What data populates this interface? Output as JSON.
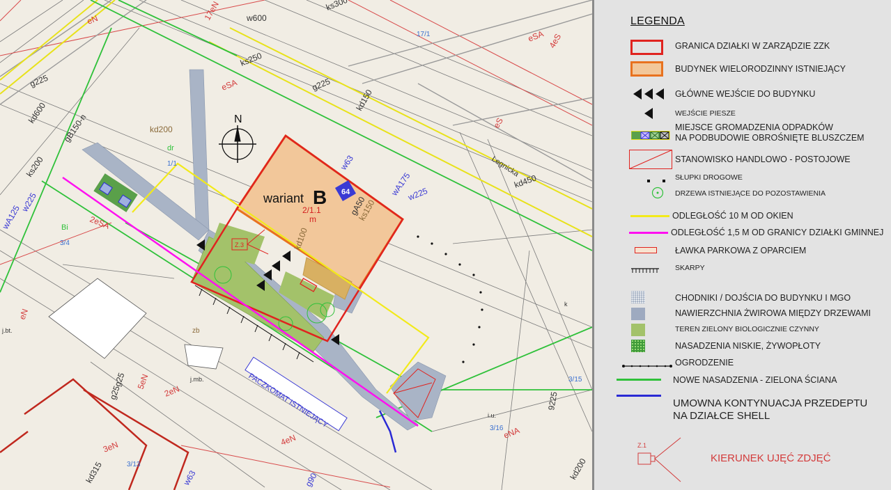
{
  "legend": {
    "title": "LEGENDA",
    "items": [
      {
        "key": "plot_border",
        "label": "GRANICA DZIAŁKI W ZARZĄDZIE ZZK"
      },
      {
        "key": "building",
        "label": "BUDYNEK WIELORODZINNY ISTNIEJĄCY"
      },
      {
        "key": "main_entrance",
        "label": "GŁÓWNE WEJŚCIE DO BUDYNKU"
      },
      {
        "key": "pedestrian_entrance",
        "label": "WEJŚCIE PIESZE"
      },
      {
        "key": "waste_area",
        "label": "MIEJSCE GROMADZENIA ODPADKÓW",
        "label2": "NA PODBUDOWIE OBROŚNIĘTE BLUSZCZEM"
      },
      {
        "key": "trade_stand",
        "label": "STANOWISKO HANDLOWO - POSTOJOWE"
      },
      {
        "key": "road_posts",
        "label": "SŁUPKI DROGOWE"
      },
      {
        "key": "trees",
        "label": "DRZEWA ISTNIEJĄCE DO POZOSTAWIENIA"
      },
      {
        "key": "dist_10m",
        "label": "ODLEGŁOŚĆ 10 M OD OKIEN"
      },
      {
        "key": "dist_1_5m",
        "label": "ODLEGŁOŚĆ 1,5 M OD GRANICY DZIAŁKI GMINNEJ"
      },
      {
        "key": "bench",
        "label": "ŁAWKA PARKOWA Z OPARCIEM"
      },
      {
        "key": "slopes",
        "label": "SKARPY"
      },
      {
        "key": "sidewalks",
        "label": "CHODNIKI / DOJŚCIA DO BUDYNKU I MGO"
      },
      {
        "key": "gravel",
        "label": "NAWIERZCHNIA ŻWIROWA MIĘDZY DRZEWAMI"
      },
      {
        "key": "green",
        "label": "TEREN ZIELONY BIOLOGICZNIE CZYNNY"
      },
      {
        "key": "low_plants",
        "label": "NASADZENIA NISKIE, ŻYWOPŁOTY"
      },
      {
        "key": "fence",
        "label": "OGRODZENIE"
      },
      {
        "key": "new_planting",
        "label": "NOWE NASADZENIA - ZIELONA ŚCIANA"
      },
      {
        "key": "pass_continuation",
        "label": "UMOWNA KONTYNUACJA PRZEDEPTU",
        "label2": "NA DZIAŁCE SHELL"
      },
      {
        "key": "photo_direction",
        "label": "KIERUNEK UJĘĆ ZDJĘĆ",
        "symbol_text": "Z.1"
      }
    ],
    "colors": {
      "plot_border": "#e0231f",
      "building_border": "#e8721f",
      "building_fill": "#f2c79a",
      "yellow": "#f2ea1a",
      "magenta": "#ff10f0",
      "green_line": "#2fc13a",
      "blue_line": "#2a2ad4",
      "sidewalk": "#a9b4c6",
      "gravel": "#9eaac0",
      "green_area": "#a3c26a",
      "low_plants": "#3f9a3a",
      "photo_red": "#d33b3b"
    }
  },
  "map": {
    "variant_label": "wariant",
    "variant_letter": "B",
    "plot_number": "2/1.1",
    "plot_unit": "m",
    "building_number": "64",
    "north": "N",
    "parcel_locker": "PACZKOMAT ISTNIEJĄCY",
    "photo_marker": "Z.3",
    "street": "Legnicka",
    "labels": [
      "eN",
      "12eN",
      "6eN",
      "15eN",
      "17eN",
      "w600",
      "g225",
      "kd150",
      "ks300",
      "ks250",
      "kd600",
      "gB150-n",
      "kd200",
      "kd450",
      "wA175",
      "w225",
      "w63",
      "gA50",
      "ks150",
      "kd100",
      "eSA",
      "4eS",
      "eS",
      "dr",
      "17/1",
      "1/1",
      "3/4",
      "3/15",
      "3/16",
      "3/13",
      "Bi",
      "2eSA",
      "wA125",
      "w225",
      "ks200",
      "g225",
      "zb",
      "j.bt.",
      "j.mb.",
      "i.u.",
      "kd315",
      "g25g25",
      "5eN",
      "2eN",
      "3eN",
      "4eN",
      "kd200",
      "w63",
      "g90",
      "ch.kp.",
      "e",
      "w",
      "k",
      "g",
      "B",
      "d",
      "ch.bt.",
      "l",
      "E",
      "9225",
      "eNA"
    ]
  }
}
